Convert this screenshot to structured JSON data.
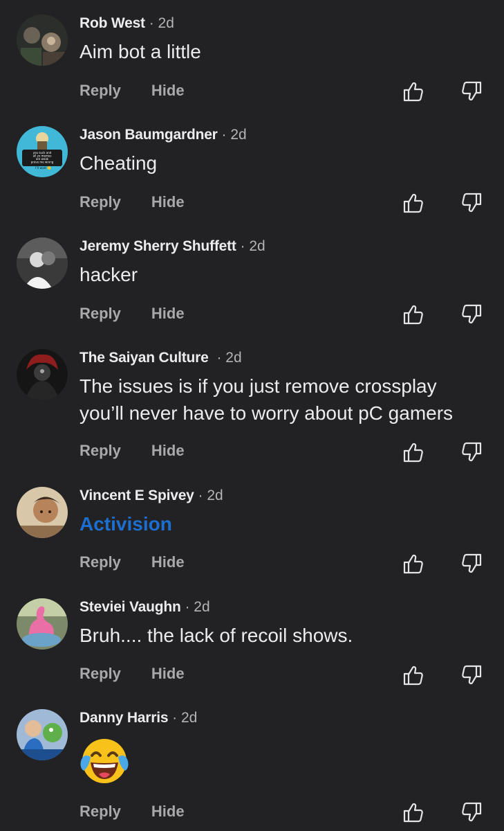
{
  "comments": [
    {
      "author": "Rob West",
      "time": "· 2d",
      "text": "Aim bot a little",
      "reply": "Reply",
      "hide": "Hide"
    },
    {
      "author": "Jason Baumgardner",
      "time": "· 2d",
      "text": "Cheating",
      "reply": "Reply",
      "hide": "Hide",
      "avatar_text": [
        "you suck and",
        "all yo memes",
        "are weak",
        "prove me wrong",
        "I'll wait"
      ]
    },
    {
      "author": "Jeremy Sherry Shuffett",
      "time": "· 2d",
      "text": "hacker",
      "reply": "Reply",
      "hide": "Hide"
    },
    {
      "author": "The Saiyan Culture",
      "time": "· 2d",
      "text_lines": [
        "The issues is if you just remove crossplay",
        "you’ll never have to worry about pC gamers"
      ],
      "reply": "Reply",
      "hide": "Hide"
    },
    {
      "author": "Vincent E Spivey",
      "time": "· 2d",
      "text": "Activision",
      "text_style": "link",
      "reply": "Reply",
      "hide": "Hide"
    },
    {
      "author": "Steviei Vaughn",
      "time": "· 2d",
      "text": "Bruh.... the lack of recoil shows.",
      "reply": "Reply",
      "hide": "Hide"
    },
    {
      "author": "Danny Harris",
      "time": "· 2d",
      "emoji": "face-with-tears-of-joy",
      "reply": "Reply",
      "hide": "Hide"
    }
  ],
  "icons": {
    "like": "thumbs-up-icon",
    "dislike": "thumbs-down-icon"
  },
  "colors": {
    "background": "#222224",
    "text": "#ececee",
    "secondary": "#b4b4b8",
    "link": "#1b6fd1"
  }
}
